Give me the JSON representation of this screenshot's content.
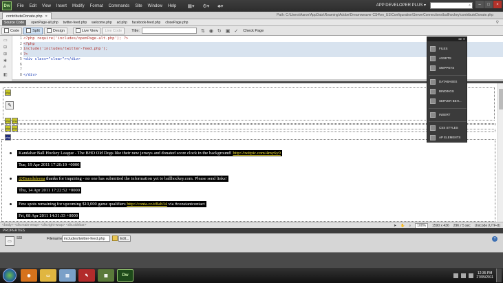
{
  "menubar": {
    "app_logo": "Dw",
    "items": [
      "File",
      "Edit",
      "View",
      "Insert",
      "Modify",
      "Format",
      "Commands",
      "Site",
      "Window",
      "Help"
    ],
    "workspace": "APP DEVELOPER PLUS ▾"
  },
  "document": {
    "tab_label": "contributeDonate.php",
    "path": "Path: C:\\Users\\Aaron\\AppData\\Roaming\\Adobe\\Dreamweaver CS4\\en_US\\Configuration\\ServerConnections\\ballhockey\\contributeDonate.php"
  },
  "related_files": {
    "source": "Source Code",
    "files": [
      "openPage-alt.php",
      "twitter-feed.php",
      "welcome.php",
      "ad.php",
      "facebook-feed.php",
      "closePage.php"
    ]
  },
  "doc_toolbar": {
    "code": "Code",
    "split": "Split",
    "design": "Design",
    "live_view": "Live View",
    "live_code": "Live Code",
    "title_label": "Title:",
    "title_value": "",
    "check_page": "Check Page"
  },
  "code": {
    "line_numbers": [
      "1",
      "2",
      "3",
      "4",
      "5",
      "6",
      "7",
      "8"
    ],
    "lines": [
      {
        "text": "<?php require('includes/openPage-alt.php'); ?>",
        "kind": "php",
        "hl": false
      },
      {
        "text": "<?php",
        "kind": "php",
        "hl": true
      },
      {
        "text": "include('includes/twitter-feed.php');",
        "kind": "php",
        "hl": true
      },
      {
        "text": "?>",
        "kind": "php",
        "hl": true
      },
      {
        "text": "<div class=\"clear\"></div>",
        "kind": "tag",
        "hl": false
      },
      {
        "text": "",
        "kind": "plain",
        "hl": false
      },
      {
        "text": "",
        "kind": "plain",
        "hl": false
      },
      {
        "text": "</div>",
        "kind": "tag",
        "hl": false
      }
    ]
  },
  "tweets": [
    {
      "text": "Kandahar Ball Hockey League - The BHO Old Dogs like their new jerseys and donated score clock in the background! ",
      "link": "http://twitpic.com/4my6y0",
      "after": "",
      "date": "Tue, 19 Apr 2011 17:20:19 +0000"
    },
    {
      "text": "",
      "link": "@Brandaleena",
      "after": " thanks for inquiring - no one has submitted the information yet to ballhockey.com. Please send links!",
      "date": "Thu, 14 Apr 2011 17:22:52 +0000"
    },
    {
      "text": "Few spots remaining for upcoming $10,000 game qualifiers ",
      "link": "http://conta.cc/eBab34",
      "after": " via #constantcontact",
      "date": "Fri, 08 Apr 2011 14:31:33 +0000"
    }
  ],
  "status": {
    "tags": "<body> <div.main-wrap> <div.right-wrap> <div.sidebar>",
    "zoom": "100%",
    "size": "1590 x 436",
    "weight": "29K / 5 sec",
    "encoding": "Unicode (UTF-8)"
  },
  "properties": {
    "header": "PROPERTIES",
    "ssi_label": "SSI",
    "filename_label": "Filename",
    "filename_value": "includes/twitter-feed.php",
    "edit_button": "Edit..."
  },
  "panel": {
    "items": [
      "FILES",
      "ASSETS",
      "SNIPPETS",
      "DATABASES",
      "BINDINGS",
      "SERVER BEH...",
      "INSERT",
      "CSS STYLES",
      "AP ELEMENTS"
    ]
  },
  "taskbar": {
    "time": "12:35 PM",
    "date": "27/05/2011",
    "dw_label": "Dw"
  }
}
